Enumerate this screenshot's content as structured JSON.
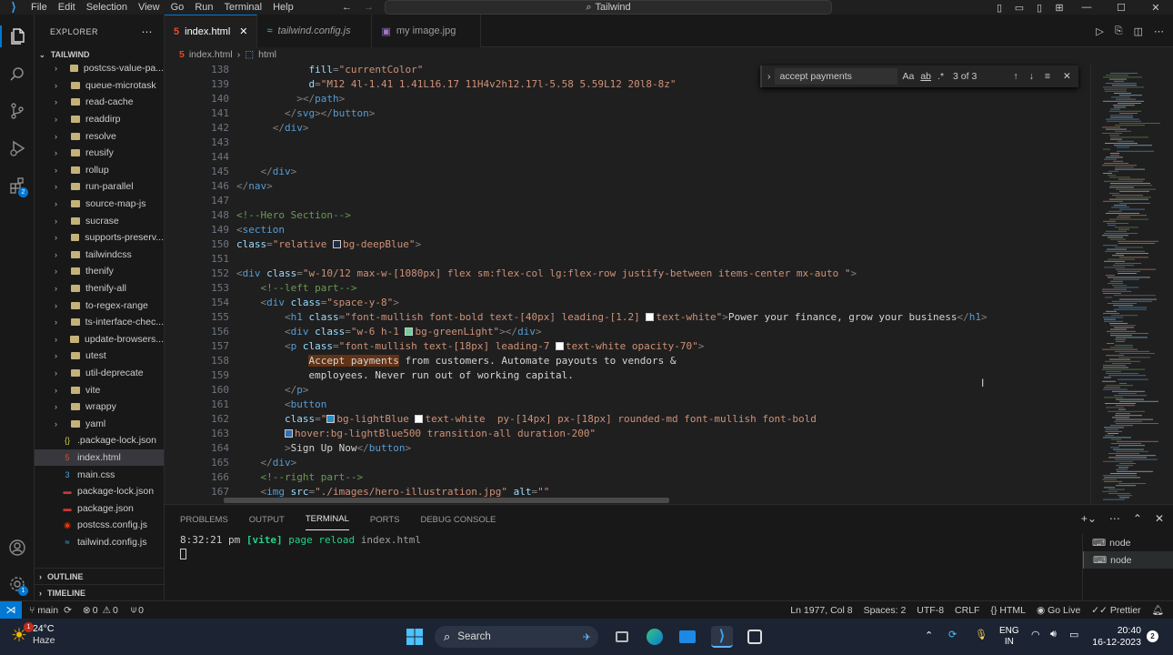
{
  "window": {
    "title": "Tailwind",
    "menu": [
      "File",
      "Edit",
      "Selection",
      "View",
      "Go",
      "Run",
      "Terminal",
      "Help"
    ]
  },
  "sidebar": {
    "header": "EXPLORER",
    "root": "TAILWIND",
    "items": [
      {
        "label": "postcss-value-pa...",
        "type": "folder"
      },
      {
        "label": "queue-microtask",
        "type": "folder"
      },
      {
        "label": "read-cache",
        "type": "folder"
      },
      {
        "label": "readdirp",
        "type": "folder"
      },
      {
        "label": "resolve",
        "type": "folder"
      },
      {
        "label": "reusify",
        "type": "folder"
      },
      {
        "label": "rollup",
        "type": "folder"
      },
      {
        "label": "run-parallel",
        "type": "folder"
      },
      {
        "label": "source-map-js",
        "type": "folder"
      },
      {
        "label": "sucrase",
        "type": "folder"
      },
      {
        "label": "supports-preserv...",
        "type": "folder"
      },
      {
        "label": "tailwindcss",
        "type": "folder"
      },
      {
        "label": "thenify",
        "type": "folder"
      },
      {
        "label": "thenify-all",
        "type": "folder"
      },
      {
        "label": "to-regex-range",
        "type": "folder"
      },
      {
        "label": "ts-interface-chec...",
        "type": "folder"
      },
      {
        "label": "update-browsers...",
        "type": "folder"
      },
      {
        "label": "utest",
        "type": "folder"
      },
      {
        "label": "util-deprecate",
        "type": "folder"
      },
      {
        "label": "vite",
        "type": "folder"
      },
      {
        "label": "wrappy",
        "type": "folder"
      },
      {
        "label": "yaml",
        "type": "folder"
      },
      {
        "label": ".package-lock.json",
        "type": "json"
      },
      {
        "label": "index.html",
        "type": "html"
      },
      {
        "label": "main.css",
        "type": "css"
      },
      {
        "label": "package-lock.json",
        "type": "pkg"
      },
      {
        "label": "package.json",
        "type": "pkg"
      },
      {
        "label": "postcss.config.js",
        "type": "postcss"
      },
      {
        "label": "tailwind.config.js",
        "type": "tw"
      }
    ],
    "outline": "OUTLINE",
    "timeline": "TIMELINE"
  },
  "tabs": [
    {
      "label": "index.html",
      "icon": "html-file-icon",
      "active": true
    },
    {
      "label": "tailwind.config.js",
      "icon": "tailwind-file-icon",
      "active": false
    },
    {
      "label": "my image.jpg",
      "icon": "image-file-icon",
      "active": false
    }
  ],
  "breadcrumb": {
    "file": "index.html",
    "node": "html"
  },
  "find": {
    "query": "accept payments",
    "count": "3 of 3"
  },
  "code": [
    {
      "n": "138",
      "html": "            <span class='at'>fill</span><span class='pn'>=</span><span class='st'>\"currentColor\"</span>"
    },
    {
      "n": "139",
      "html": "            <span class='at'>d</span><span class='pn'>=</span><span class='st'>\"M12 4l-1.41 1.41L16.17 11H4v2h12.17l-5.58 5.59L12 20l8-8z\"</span>"
    },
    {
      "n": "140",
      "html": "          <span class='pn'>&gt;&lt;/</span><span class='tag'>path</span><span class='pn'>&gt;</span>"
    },
    {
      "n": "141",
      "html": "        <span class='pn'>&lt;/</span><span class='tag'>svg</span><span class='pn'>&gt;&lt;/</span><span class='tag'>button</span><span class='pn'>&gt;</span>"
    },
    {
      "n": "142",
      "html": "      <span class='pn'>&lt;/</span><span class='tag'>div</span><span class='pn'>&gt;</span>"
    },
    {
      "n": "143",
      "html": ""
    },
    {
      "n": "144",
      "html": ""
    },
    {
      "n": "145",
      "html": "    <span class='pn'>&lt;/</span><span class='tag'>div</span><span class='pn'>&gt;</span>"
    },
    {
      "n": "146",
      "html": "<span class='pn'>&lt;/</span><span class='tag'>nav</span><span class='pn'>&gt;</span>"
    },
    {
      "n": "147",
      "html": ""
    },
    {
      "n": "148",
      "html": "<span class='cm'>&lt;!--Hero Section--&gt;</span>"
    },
    {
      "n": "149",
      "html": "<span class='pn'>&lt;</span><span class='tag'>section</span>"
    },
    {
      "n": "150",
      "html": "<span class='at'>class</span><span class='pn'>=</span><span class='st'>\"relative <span class='sw' style='background:#1e2a4a'></span>bg-deepBlue\"</span><span class='pn'>&gt;</span>"
    },
    {
      "n": "151",
      "html": ""
    },
    {
      "n": "152",
      "html": "<span class='pn'>&lt;</span><span class='tag'>div</span> <span class='at'>class</span><span class='pn'>=</span><span class='st'>\"w-10/12 max-w-[1080px] flex sm:flex-col lg:flex-row justify-between items-center mx-auto \"</span><span class='pn'>&gt;</span>"
    },
    {
      "n": "153",
      "html": "    <span class='cm'>&lt;!--left part--&gt;</span>"
    },
    {
      "n": "154",
      "html": "    <span class='pn'>&lt;</span><span class='tag'>div</span> <span class='at'>class</span><span class='pn'>=</span><span class='st'>\"space-y-8\"</span><span class='pn'>&gt;</span>"
    },
    {
      "n": "155",
      "html": "        <span class='pn'>&lt;</span><span class='tag'>h1</span> <span class='at'>class</span><span class='pn'>=</span><span class='st'>\"font-mullish font-bold text-[40px] leading-[1.2] <span class='sw' style='background:#fff'></span>text-white\"</span><span class='pn'>&gt;</span>Power your finance, grow your business<span class='pn'>&lt;/</span><span class='tag'>h1</span><span class='pn'>&gt;</span>"
    },
    {
      "n": "156",
      "html": "        <span class='pn'>&lt;</span><span class='tag'>div</span> <span class='at'>class</span><span class='pn'>=</span><span class='st'>\"w-6 h-1 <span class='sw' style='background:#6fcf97'></span>bg-greenLight\"</span><span class='pn'>&gt;&lt;/</span><span class='tag'>div</span><span class='pn'>&gt;</span>"
    },
    {
      "n": "157",
      "html": "        <span class='pn'>&lt;</span><span class='tag'>p</span> <span class='at'>class</span><span class='pn'>=</span><span class='st'>\"font-mullish text-[18px] leading-7 <span class='sw' style='background:#fff'></span>text-white opacity-70\"</span><span class='pn'>&gt;</span>"
    },
    {
      "n": "158",
      "html": "            <span class='hl'>Accept payments</span> from customers. Automate payouts to vendors &amp;"
    },
    {
      "n": "159",
      "html": "            employees. Never run out of working capital."
    },
    {
      "n": "160",
      "html": "        <span class='pn'>&lt;/</span><span class='tag'>p</span><span class='pn'>&gt;</span>"
    },
    {
      "n": "161",
      "html": "        <span class='pn'>&lt;</span><span class='tag'>button</span>"
    },
    {
      "n": "162",
      "html": "        <span class='at'>class</span><span class='pn'>=</span><span class='st'>\"<span class='sw' style='background:#2e8bc9'></span>bg-lightBlue <span class='sw' style='background:#fff'></span>text-white  py-[14px] px-[18px] rounded-md font-mullish font-bold</span>"
    },
    {
      "n": "163",
      "html": "        <span class='st'><span class='sw' style='background:#2f6fb6'></span>hover:bg-lightBlue500 transition-all duration-200\"</span>"
    },
    {
      "n": "164",
      "html": "        <span class='pn'>&gt;</span>Sign Up Now<span class='pn'>&lt;/</span><span class='tag'>button</span><span class='pn'>&gt;</span>"
    },
    {
      "n": "165",
      "html": "    <span class='pn'>&lt;/</span><span class='tag'>div</span><span class='pn'>&gt;</span>"
    },
    {
      "n": "166",
      "html": "    <span class='cm'>&lt;!--right part--&gt;</span>"
    },
    {
      "n": "167",
      "html": "    <span class='pn'>&lt;</span><span class='tag'>img</span> <span class='at'>src</span><span class='pn'>=</span><span class='st'>\"./images/hero-illustration.jpg\"</span> <span class='at'>alt</span><span class='pn'>=</span><span class='st'>\"\"</span>"
    }
  ],
  "panel": {
    "tabs": [
      "PROBLEMS",
      "OUTPUT",
      "TERMINAL",
      "PORTS",
      "DEBUG CONSOLE"
    ],
    "active": "TERMINAL",
    "line_time": "8:32:21 pm",
    "line_tag": "[vite]",
    "line_msg": "page reload",
    "line_file": "index.html",
    "terminals": [
      "node",
      "node"
    ]
  },
  "status": {
    "branch": "main",
    "errors": "0",
    "warnings": "0",
    "ports": "0",
    "position": "Ln 1977, Col 8",
    "spaces": "Spaces: 2",
    "encoding": "UTF-8",
    "eol": "CRLF",
    "language": "HTML",
    "golive": "Go Live",
    "prettier": "Prettier"
  },
  "taskbar": {
    "temp": "24°C",
    "weather": "Haze",
    "search": "Search",
    "lang1": "ENG",
    "lang2": "IN",
    "time": "20:40",
    "date": "16-12-2023",
    "notif": "2"
  },
  "colors": {
    "accent": "#0078d4",
    "bg": "#1f1f1f",
    "sidebar": "#181818",
    "taskbar": "#1c2433"
  }
}
